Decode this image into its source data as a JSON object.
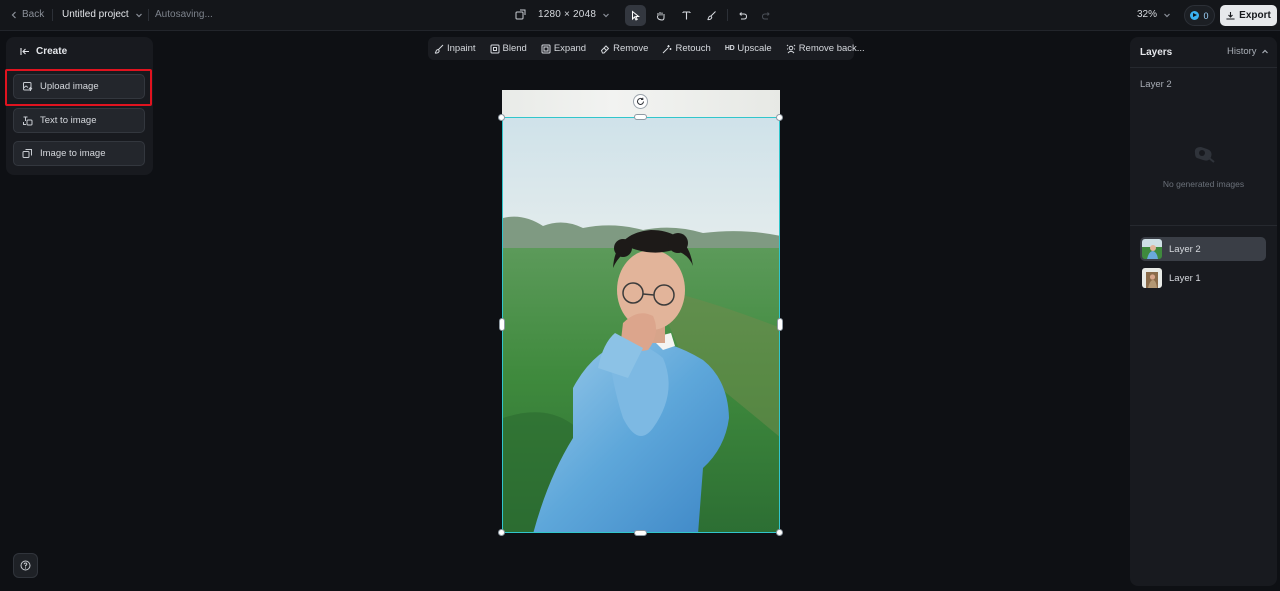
{
  "topbar": {
    "back_label": "Back",
    "project_name": "Untitled project",
    "autosave_status": "Autosaving...",
    "canvas_size": "1280 × 2048",
    "zoom": "32%",
    "credits": "0",
    "export_label": "Export"
  },
  "left_panel": {
    "title": "Create",
    "buttons": [
      {
        "label": "Upload image",
        "icon": "upload-image-icon"
      },
      {
        "label": "Text to image",
        "icon": "text-to-image-icon"
      },
      {
        "label": "Image to image",
        "icon": "image-to-image-icon"
      }
    ]
  },
  "edit_toolbar": {
    "items": [
      {
        "label": "Inpaint",
        "icon": "brush-icon"
      },
      {
        "label": "Blend",
        "icon": "blend-icon"
      },
      {
        "label": "Expand",
        "icon": "expand-icon"
      },
      {
        "label": "Remove",
        "icon": "eraser-icon"
      },
      {
        "label": "Retouch",
        "icon": "sparkle-icon"
      },
      {
        "label": "Upscale",
        "icon": "hd-icon",
        "badge": "HD"
      },
      {
        "label": "Remove back...",
        "icon": "remove-background-icon"
      }
    ]
  },
  "right_panel": {
    "title": "Layers",
    "history_label": "History",
    "current_layer": "Layer 2",
    "empty_text": "No generated images",
    "layers": [
      {
        "name": "Layer 2",
        "selected": true
      },
      {
        "name": "Layer 1",
        "selected": false
      }
    ]
  },
  "colors": {
    "accent_selection": "#31c6cc",
    "highlight_box": "#e0131f",
    "export_bg": "#e6e8eb"
  }
}
